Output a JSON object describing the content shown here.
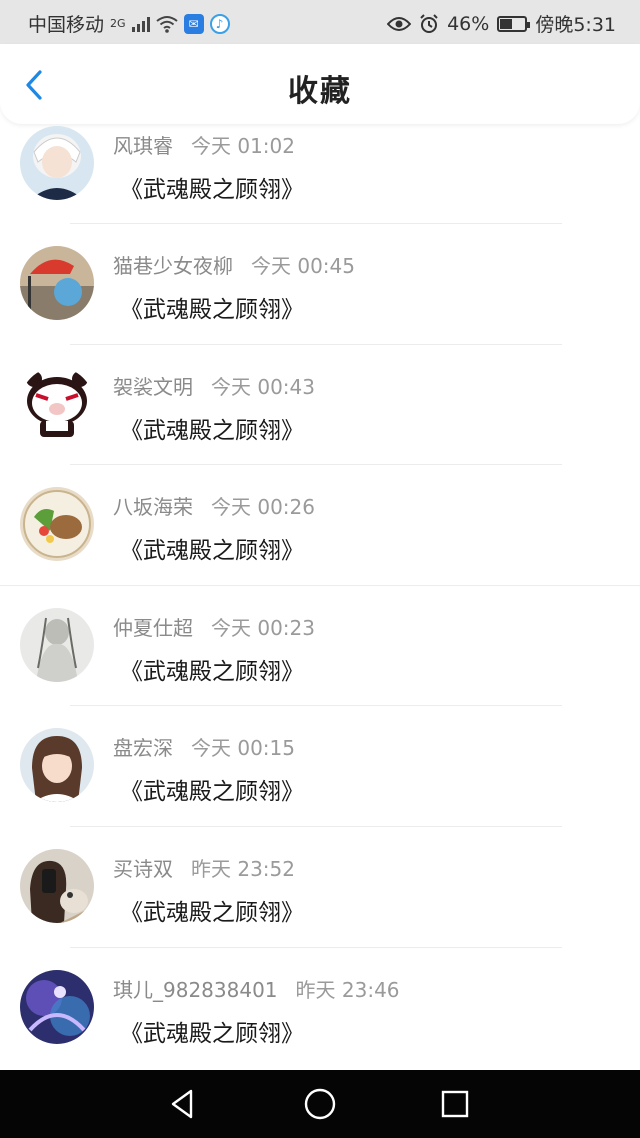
{
  "status_bar": {
    "carrier": "中国移动",
    "network": "2G",
    "battery": "46%",
    "time": "傍晚5:31"
  },
  "header": {
    "title": "收藏"
  },
  "items": [
    {
      "name": "风琪睿",
      "time": "今天 01:02",
      "work": "《武魂殿之顾翎》",
      "avatar": "white-hair-anime-avatar"
    },
    {
      "name": "猫巷少女夜柳",
      "time": "今天 00:45",
      "work": "《武魂殿之顾翎》",
      "avatar": "red-umbrella-painting-avatar"
    },
    {
      "name": "袈裟文明",
      "time": "今天 00:43",
      "work": "《武魂殿之顾翎》",
      "avatar": "cartoon-panda-avatar"
    },
    {
      "name": "八坂海荣",
      "time": "今天 00:26",
      "work": "《武魂殿之顾翎》",
      "avatar": "food-plate-avatar"
    },
    {
      "name": "仲夏仕超",
      "time": "今天 00:23",
      "work": "《武魂殿之顾翎》",
      "avatar": "sketch-figure-avatar"
    },
    {
      "name": "盘宏深",
      "time": "今天 00:15",
      "work": "《武魂殿之顾翎》",
      "avatar": "girl-photo-avatar"
    },
    {
      "name": "买诗双",
      "time": "昨天 23:52",
      "work": "《武魂殿之顾翎》",
      "avatar": "mirror-selfie-dog-avatar"
    },
    {
      "name": "琪儿_982838401",
      "time": "昨天 23:46",
      "work": "《武魂殿之顾翎》",
      "avatar": "purple-fantasy-avatar"
    }
  ],
  "colors": {
    "accent": "#1e88e5",
    "status_bar_bg": "#e6e6e6",
    "nav_bar_bg": "#050505"
  },
  "nav": {
    "back": "back-triangle-icon",
    "home": "home-circle-icon",
    "recent": "recent-square-icon"
  }
}
